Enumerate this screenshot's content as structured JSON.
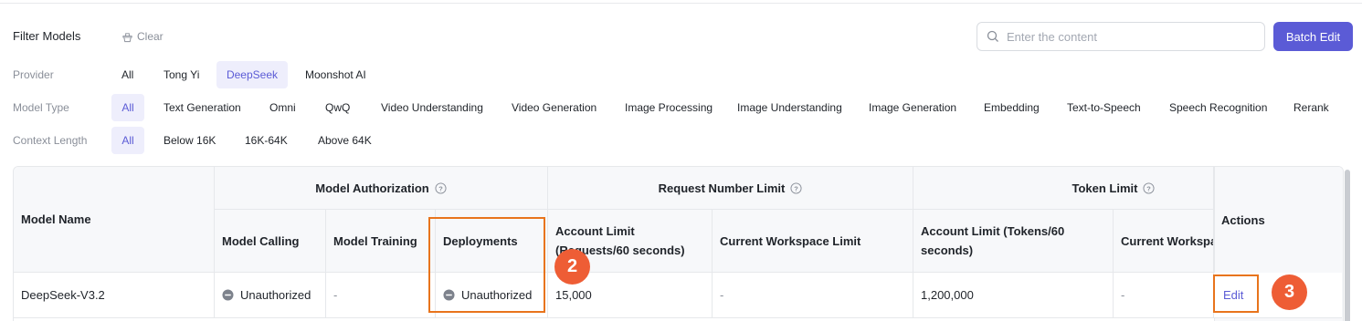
{
  "filter": {
    "title": "Filter Models",
    "clear_label": "Clear",
    "search_placeholder": "Enter the content",
    "batch_edit_label": "Batch Edit"
  },
  "rows": {
    "provider": {
      "label": "Provider",
      "options": [
        "All",
        "Tong Yi",
        "DeepSeek",
        "Moonshot AI"
      ],
      "selected": "DeepSeek"
    },
    "model_type": {
      "label": "Model Type",
      "options": [
        "All",
        "Text Generation",
        "Omni",
        "QwQ",
        "Video Understanding",
        "Video Generation",
        "Image Processing",
        "Image Understanding",
        "Image Generation",
        "Embedding",
        "Text-to-Speech",
        "Speech Recognition",
        "Rerank"
      ],
      "selected": "All"
    },
    "context_length": {
      "label": "Context Length",
      "options": [
        "All",
        "Below 16K",
        "16K-64K",
        "Above 64K"
      ],
      "selected": "All"
    }
  },
  "table": {
    "headers": {
      "model_name": "Model Name",
      "model_authorization": "Model Authorization",
      "request_number_limit": "Request Number Limit",
      "token_limit": "Token Limit",
      "actions": "Actions",
      "model_calling": "Model Calling",
      "model_training": "Model Training",
      "deployments": "Deployments",
      "req_account_limit": "Account Limit (Requests/60 seconds)",
      "req_workspace_limit": "Current Workspace Limit",
      "tok_account_limit": "Account Limit (Tokens/60 seconds)",
      "tok_workspace_limit": "Current Workspace Limit"
    },
    "row": {
      "model_name": "DeepSeek-V3.2",
      "model_calling": "Unauthorized",
      "model_training": "-",
      "deployments": "Unauthorized",
      "req_account_limit": "15,000",
      "req_workspace_limit": "-",
      "tok_account_limit": "1,200,000",
      "tok_workspace_limit": "-",
      "action": "Edit"
    }
  },
  "callouts": [
    "2",
    "3"
  ],
  "colors": {
    "accent": "#5b5bd6",
    "callout": "#ee5d35",
    "callout_border": "#e8741c"
  }
}
